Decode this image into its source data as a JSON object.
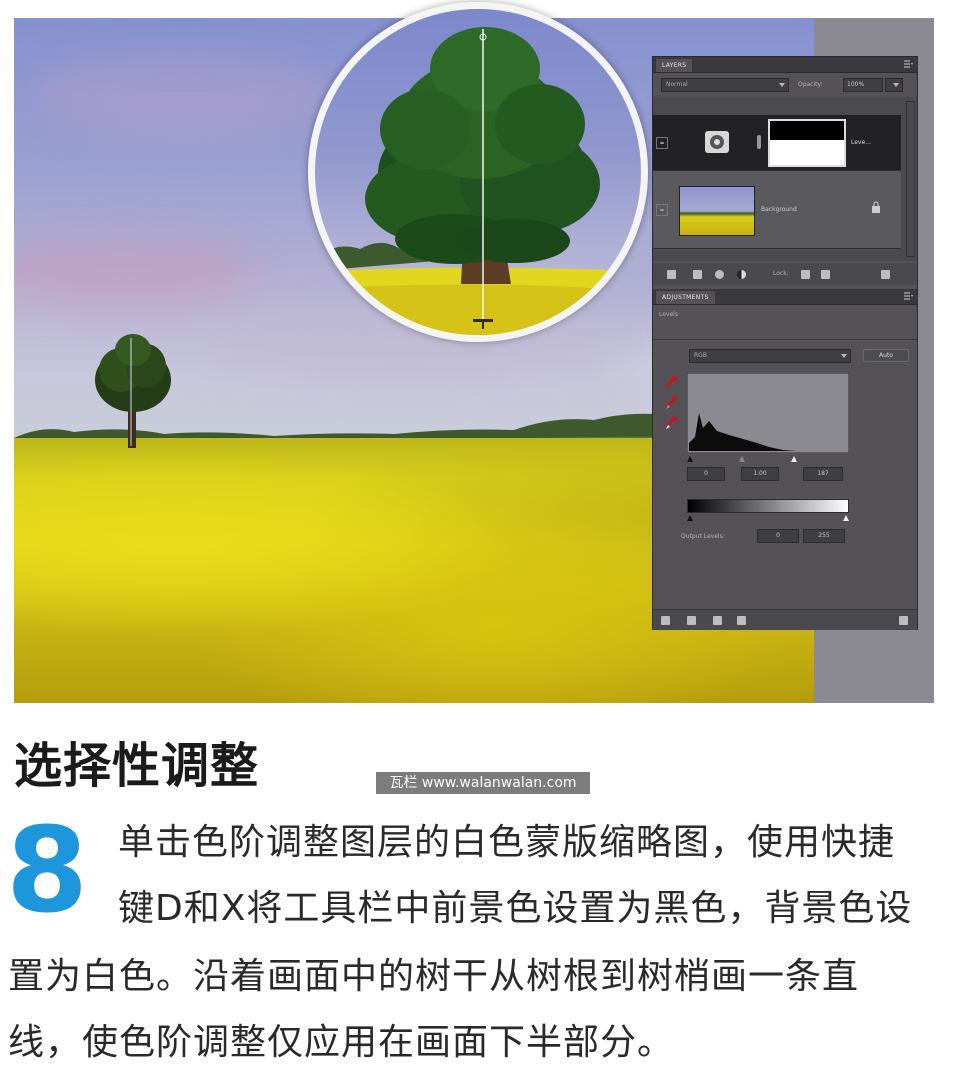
{
  "photo": {
    "description_icons": [
      "oak-tree",
      "rapeseed-field"
    ],
    "colors": {
      "sky": "#8f98cf",
      "field": "#e0d41a",
      "panel": "#545257",
      "accent_blue": "#1e96dc"
    }
  },
  "layers_panel": {
    "tab_label": "LAYERS",
    "blend_mode": "Normal",
    "opacity_label": "Opacity:",
    "opacity_value": "100%",
    "layers": [
      {
        "name": "Leve..."
      },
      {
        "name": "Background"
      }
    ],
    "lock_label": "Lock:"
  },
  "adjustments_panel": {
    "tab_label": "ADJUSTMENTS",
    "subtitle": "Levels",
    "preset": "RGB",
    "auto_label": "Auto",
    "input_levels": [
      "0",
      "1.00",
      "187"
    ],
    "output_label": "Output Levels:",
    "output_levels": [
      "0",
      "255"
    ]
  },
  "article": {
    "title": "选择性调整",
    "watermark": "瓦栏 www.walanwalan.com",
    "step_number": "8",
    "body_lines": [
      "单击色阶调整图层的白色蒙版缩略图，使用快捷",
      "键D和X将工具栏中前景色设置为黑色，背景色设",
      "置为白色。沿着画面中的树干从树根到树梢画一条直",
      "线，使色阶调整仅应用在画面下半部分。"
    ]
  }
}
